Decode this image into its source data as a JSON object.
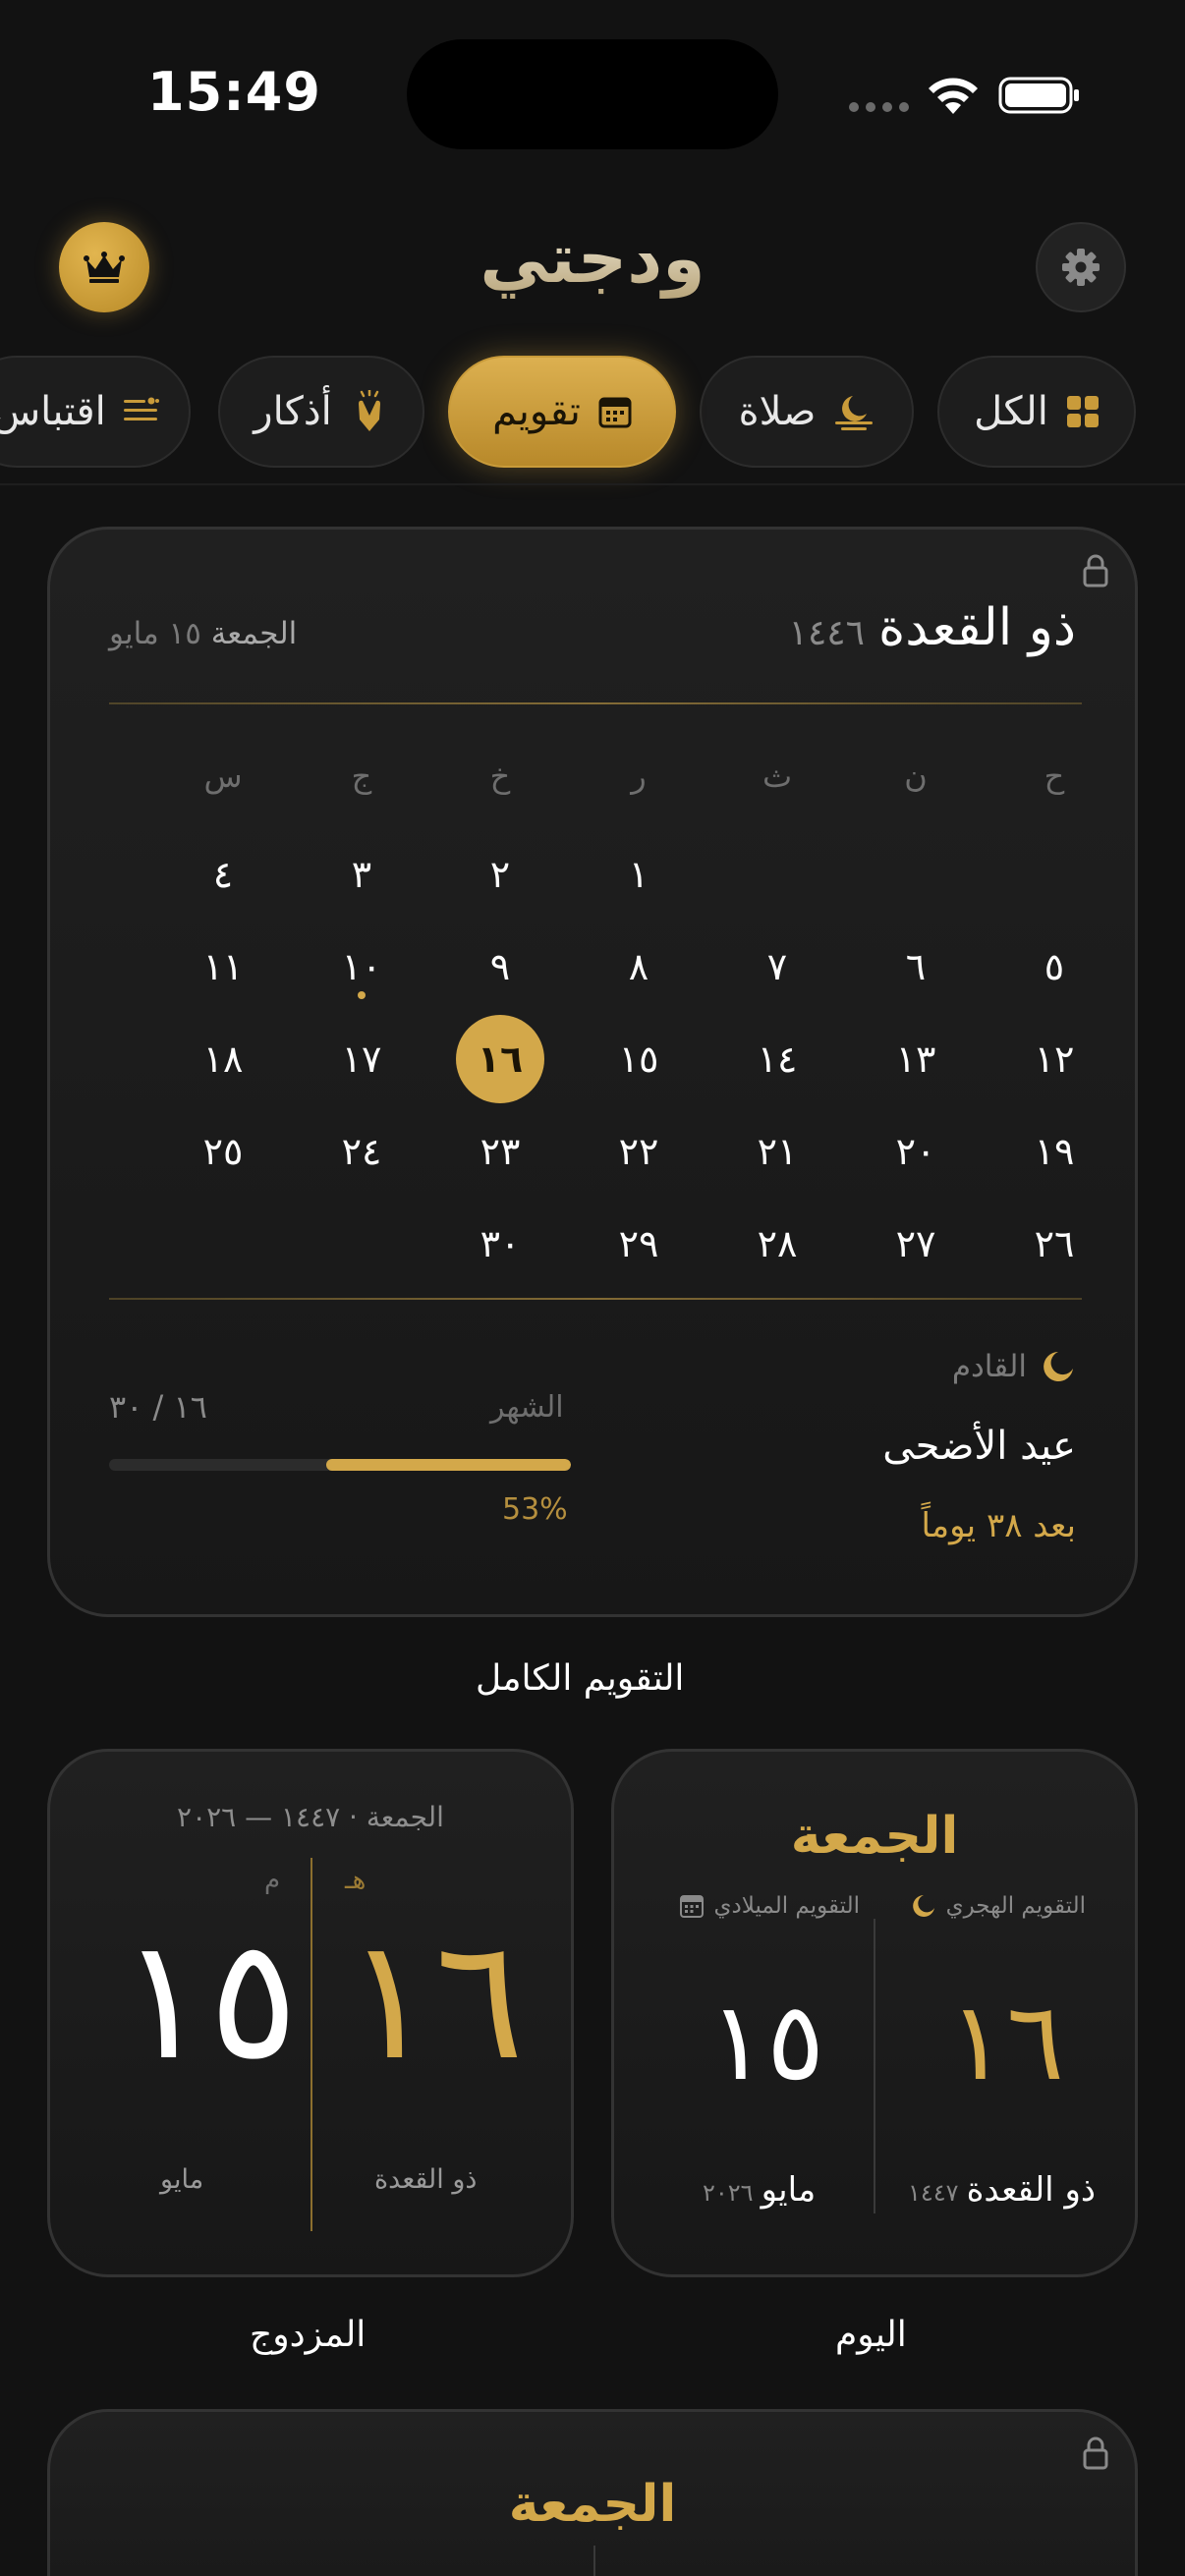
{
  "status": {
    "time": "15:49"
  },
  "header": {
    "title": "ودجتي",
    "crown_icon": "crown-icon",
    "settings_icon": "gear-icon"
  },
  "tabs": [
    {
      "label": "الكل",
      "icon": "grid-icon",
      "active": false
    },
    {
      "label": "صلاة",
      "icon": "crescent-icon",
      "active": false
    },
    {
      "label": "تقويم",
      "icon": "calendar-icon",
      "active": true
    },
    {
      "label": "أذكار",
      "icon": "praying-hands-icon",
      "active": false
    },
    {
      "label": "اقتباس",
      "icon": "quote-icon",
      "active": false
    }
  ],
  "calendar_widget": {
    "hijri_month": "ذو القعدة",
    "hijri_year": "١٤٤٦",
    "weekday": "الجمعة",
    "gregorian_date": "١٥ مايو",
    "weekday_headers": [
      "ح",
      "ن",
      "ث",
      "ر",
      "خ",
      "ج",
      "س"
    ],
    "weeks": [
      [
        "",
        "",
        "",
        "١",
        "٢",
        "٣",
        "٤"
      ],
      [
        "٥",
        "٦",
        "٧",
        "٨",
        "٩",
        "١٠",
        "١١"
      ],
      [
        "١٢",
        "١٣",
        "١٤",
        "١٥",
        "١٦",
        "١٧",
        "١٨"
      ],
      [
        "١٩",
        "٢٠",
        "٢١",
        "٢٢",
        "٢٣",
        "٢٤",
        "٢٥"
      ],
      [
        "٢٦",
        "٢٧",
        "٢٨",
        "٢٩",
        "٣٠",
        "",
        ""
      ]
    ],
    "today": "١٦",
    "marked_day": "١٠",
    "next_label": "القادم",
    "next_event": "عيد الأضحى",
    "next_in": "بعد ٣٨ يوماً",
    "month_label": "الشهر",
    "month_count": "١٦ / ٣٠",
    "month_progress": 0.53,
    "month_percent": "53%",
    "caption": "التقويم الكامل"
  },
  "dual_widget": {
    "date_line": "الجمعة · ١٤٤٧ — ٢٠٢٦",
    "hijri_tag": "هـ",
    "gregorian_tag": "م",
    "hijri_day": "١٦",
    "gregorian_day": "١٥",
    "hijri_month": "ذو القعدة",
    "gregorian_month": "مايو",
    "caption": "المزدوج"
  },
  "today_widget": {
    "weekday": "الجمعة",
    "hijri_label": "التقويم الهجري",
    "gregorian_label": "التقويم الميلادي",
    "hijri_day": "١٦",
    "gregorian_day": "١٥",
    "hijri_month": "ذو القعدة",
    "hijri_year": "١٤٤٧",
    "gregorian_month": "مايو",
    "gregorian_year": "٢٠٢٦",
    "caption": "اليوم"
  },
  "bottom_widget": {
    "weekday": "الجمعة"
  },
  "colors": {
    "accent": "#d3a84a",
    "background": "#121212",
    "card": "#1c1c1c"
  }
}
